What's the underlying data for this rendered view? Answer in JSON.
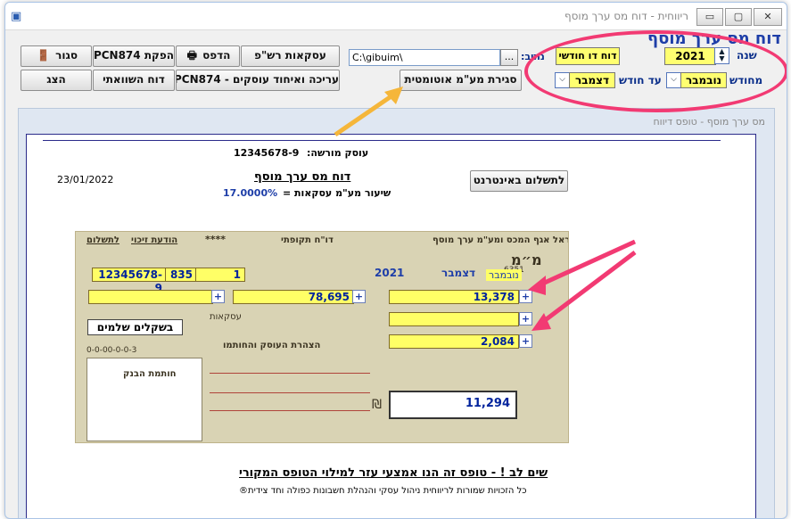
{
  "window": {
    "title": "ריווחית - דוח מס ערך מוסף",
    "controls": {
      "min": "▭",
      "max": "▢",
      "close": "✕"
    }
  },
  "toolbar": {
    "close": "סגור",
    "report_pcn874": "הפקת PCN874",
    "print": "הדפס",
    "ledger_transactions": "עסקאות רש\"פ",
    "show": "הצג",
    "comparison_report": "דוח השוואתי",
    "edit_merge": "עריכה ואיחוד עוסקים - PCN874",
    "auto_close": "סגירת מע\"מ אוטומטית"
  },
  "path": {
    "label": "נתיב:",
    "value": "C:\\gibuim\\",
    "browse": "..."
  },
  "report_type": {
    "value": "דוח דו חודשי"
  },
  "period": {
    "heading": "דוח מס ערך מוסף",
    "year_label": "שנה",
    "year": "2021",
    "from_month_label": "מחודש",
    "from_month": "נובמבר",
    "to_month_label": "עד חודש",
    "to_month": "דצמבר"
  },
  "subwindow": {
    "title": "מס ערך מוסף - טופס דיווח"
  },
  "report": {
    "dealer_label": "עוסק מורשה:",
    "dealer_id": "12345678-9",
    "date": "23/01/2022",
    "pay_online": "לתשלום באינטרנט",
    "title": "דוח מס ערך מוסף",
    "rate_label": "שיעור מע\"מ עסקאות =",
    "rate": "17.0000%",
    "note_title": "שים לב ! - טופס זה הנו אמצעי עזר למילוי הטופס המקורי",
    "copyright": "כל הזכויות שמורות לריווחית ניהול עסקי והנהלת חשבונות כפולה וחד צידית®"
  },
  "form": {
    "header_right": "מדינת ישראל אגף המכס ומע\"מ ערך מוסף",
    "header_mid": "דו\"ח תקופתי",
    "header_left": "הודעת זיכוי",
    "header_left2": "לתשלום",
    "stars": "****",
    "dealer_id": "12345678-9",
    "branch": "835",
    "branch2": "1",
    "year": "2021",
    "month_to": "דצמבר",
    "month_from": "נובמבר",
    "vat_on_sales": "13,378",
    "taxable_sales": "78,695",
    "vat_on_inputs_fixed": "",
    "vat_on_inputs_other": "2,084",
    "total_to_pay": "11,294",
    "in_shekels": "בשקלים שלמים",
    "bank_stamp": "חותמת הבנק",
    "declaration": "הצהרת העוסק והחותמו",
    "transactions_label": "עסקאות",
    "shekel_sign": "₪",
    "code": "6351",
    "serial": "0-0-00-0-0-3"
  },
  "icons": {
    "close": "door-icon",
    "print": "printer-icon",
    "pcn": "export-icon",
    "ledger": "document-icon"
  },
  "colors": {
    "highlight": "#f23a73",
    "arrow": "#f5b63a",
    "accent": "#1e3ea8"
  }
}
